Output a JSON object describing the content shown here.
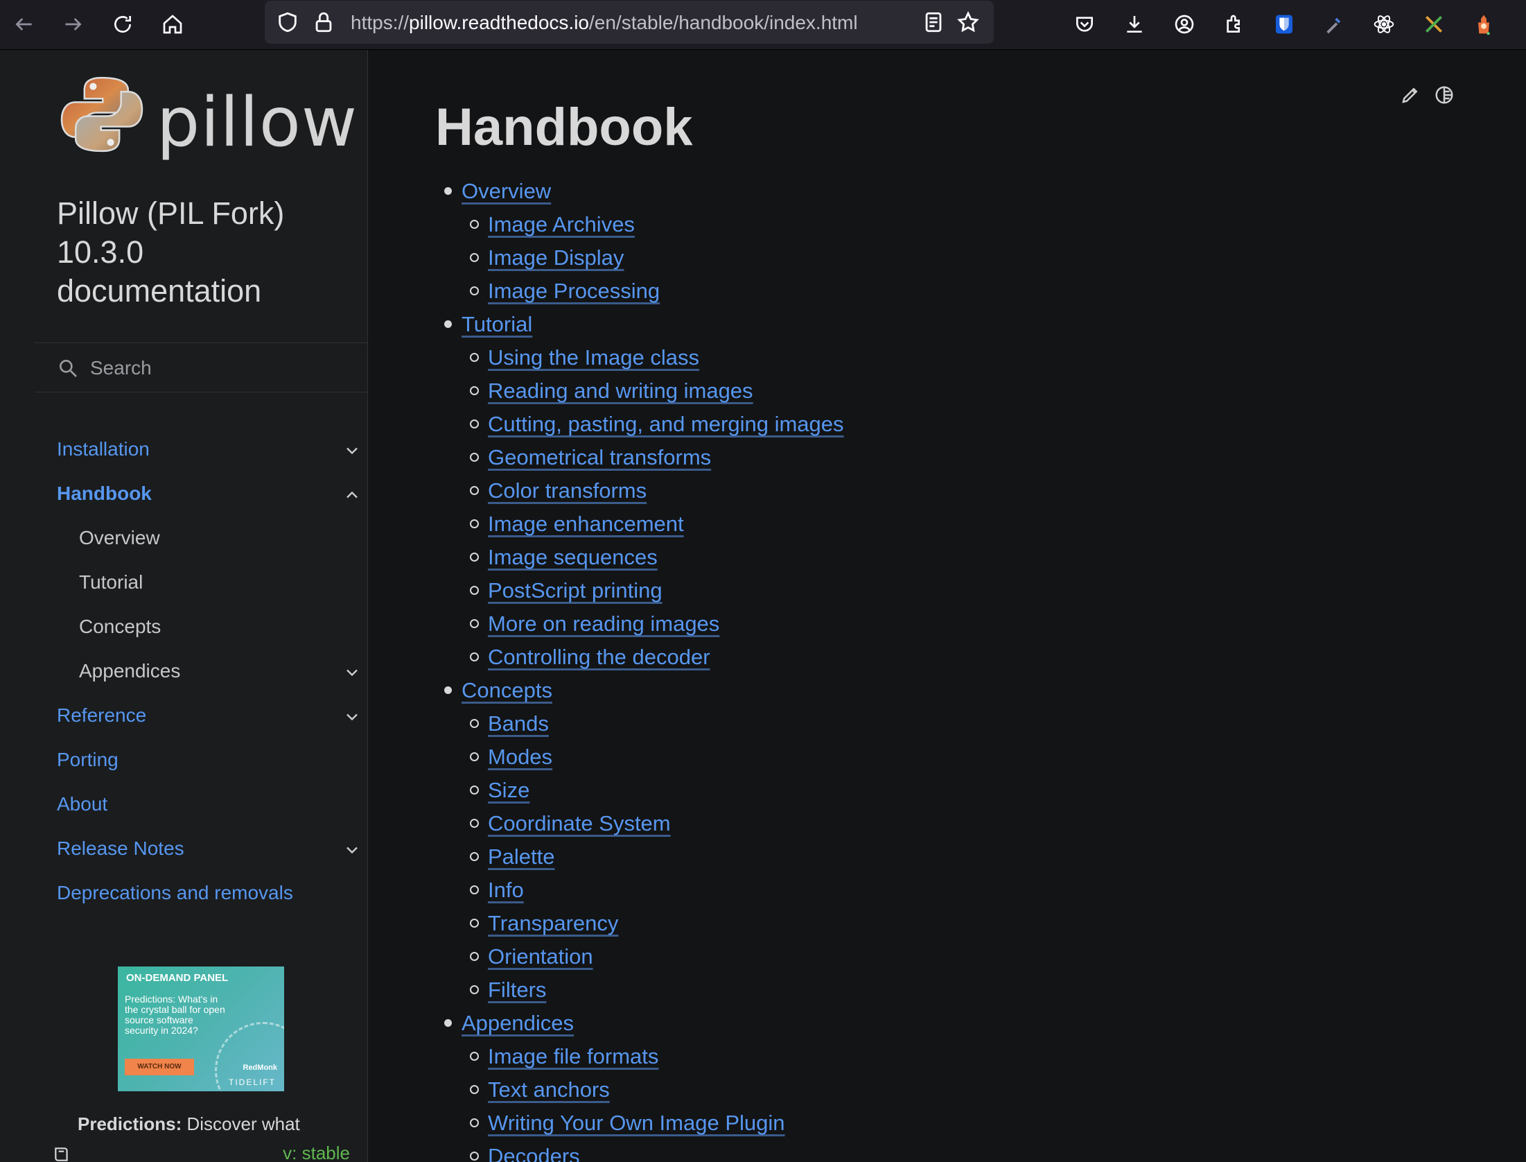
{
  "browser": {
    "url_prefix": "https://",
    "url_host": "pillow.readthedocs.io",
    "url_path": "/en/stable/handbook/index.html"
  },
  "sidebar": {
    "logo_text": "pillow",
    "project_title": "Pillow (PIL Fork) 10.3.0 documentation",
    "search_placeholder": "Search",
    "items": [
      {
        "label": "Installation"
      },
      {
        "label": "Handbook"
      },
      {
        "label": "Overview"
      },
      {
        "label": "Tutorial"
      },
      {
        "label": "Concepts"
      },
      {
        "label": "Appendices"
      },
      {
        "label": "Reference"
      },
      {
        "label": "Porting"
      },
      {
        "label": "About"
      },
      {
        "label": "Release Notes"
      },
      {
        "label": "Deprecations and removals"
      }
    ],
    "ad": {
      "label": "ON-DEMAND  PANEL",
      "text": "Predictions: What's in the crystal ball for open source software security in 2024?",
      "button": "WATCH NOW",
      "brand1": "RedMonk",
      "brand2": "TIDELIFT",
      "caption_bold": "Predictions:",
      "caption_rest": " Discover what"
    },
    "version": "v: stable"
  },
  "main": {
    "title": "Handbook",
    "sections": [
      {
        "label": "Overview",
        "children": [
          "Image Archives",
          "Image Display",
          "Image Processing"
        ]
      },
      {
        "label": "Tutorial",
        "children": [
          "Using the Image class",
          "Reading and writing images",
          "Cutting, pasting, and merging images",
          "Geometrical transforms",
          "Color transforms",
          "Image enhancement",
          "Image sequences",
          "PostScript printing",
          "More on reading images",
          "Controlling the decoder"
        ]
      },
      {
        "label": "Concepts",
        "children": [
          "Bands",
          "Modes",
          "Size",
          "Coordinate System",
          "Palette",
          "Info",
          "Transparency",
          "Orientation",
          "Filters"
        ]
      },
      {
        "label": "Appendices",
        "children": [
          "Image file formats",
          "Text anchors",
          "Writing Your Own Image Plugin",
          "Decoders"
        ]
      }
    ]
  }
}
